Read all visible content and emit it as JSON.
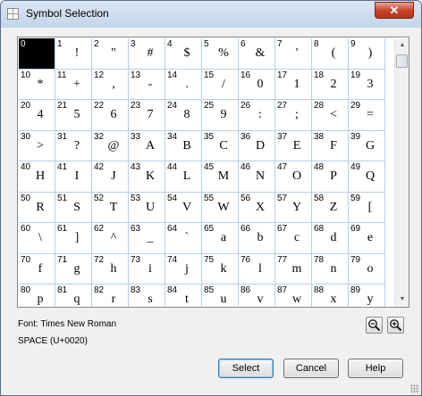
{
  "window": {
    "title": "Symbol Selection",
    "close_glyph": "✕"
  },
  "grid": {
    "columns": 10,
    "selected_code": "0",
    "cells": [
      {
        "code": "0",
        "glyph": ""
      },
      {
        "code": "1",
        "glyph": "!"
      },
      {
        "code": "2",
        "glyph": "\""
      },
      {
        "code": "3",
        "glyph": "#"
      },
      {
        "code": "4",
        "glyph": "$"
      },
      {
        "code": "5",
        "glyph": "%"
      },
      {
        "code": "6",
        "glyph": "&"
      },
      {
        "code": "7",
        "glyph": "'"
      },
      {
        "code": "8",
        "glyph": "("
      },
      {
        "code": "9",
        "glyph": ")"
      },
      {
        "code": "10",
        "glyph": "*"
      },
      {
        "code": "11",
        "glyph": "+"
      },
      {
        "code": "12",
        "glyph": ","
      },
      {
        "code": "13",
        "glyph": "-"
      },
      {
        "code": "14",
        "glyph": "."
      },
      {
        "code": "15",
        "glyph": "/"
      },
      {
        "code": "16",
        "glyph": "0"
      },
      {
        "code": "17",
        "glyph": "1"
      },
      {
        "code": "18",
        "glyph": "2"
      },
      {
        "code": "19",
        "glyph": "3"
      },
      {
        "code": "20",
        "glyph": "4"
      },
      {
        "code": "21",
        "glyph": "5"
      },
      {
        "code": "22",
        "glyph": "6"
      },
      {
        "code": "23",
        "glyph": "7"
      },
      {
        "code": "24",
        "glyph": "8"
      },
      {
        "code": "25",
        "glyph": "9"
      },
      {
        "code": "26",
        "glyph": ":"
      },
      {
        "code": "27",
        "glyph": ";"
      },
      {
        "code": "28",
        "glyph": "<"
      },
      {
        "code": "29",
        "glyph": "="
      },
      {
        "code": "30",
        "glyph": ">"
      },
      {
        "code": "31",
        "glyph": "?"
      },
      {
        "code": "32",
        "glyph": "@"
      },
      {
        "code": "33",
        "glyph": "A"
      },
      {
        "code": "34",
        "glyph": "B"
      },
      {
        "code": "35",
        "glyph": "C"
      },
      {
        "code": "36",
        "glyph": "D"
      },
      {
        "code": "37",
        "glyph": "E"
      },
      {
        "code": "38",
        "glyph": "F"
      },
      {
        "code": "39",
        "glyph": "G"
      },
      {
        "code": "40",
        "glyph": "H"
      },
      {
        "code": "41",
        "glyph": "I"
      },
      {
        "code": "42",
        "glyph": "J"
      },
      {
        "code": "43",
        "glyph": "K"
      },
      {
        "code": "44",
        "glyph": "L"
      },
      {
        "code": "45",
        "glyph": "M"
      },
      {
        "code": "46",
        "glyph": "N"
      },
      {
        "code": "47",
        "glyph": "O"
      },
      {
        "code": "48",
        "glyph": "P"
      },
      {
        "code": "49",
        "glyph": "Q"
      },
      {
        "code": "50",
        "glyph": "R"
      },
      {
        "code": "51",
        "glyph": "S"
      },
      {
        "code": "52",
        "glyph": "T"
      },
      {
        "code": "53",
        "glyph": "U"
      },
      {
        "code": "54",
        "glyph": "V"
      },
      {
        "code": "55",
        "glyph": "W"
      },
      {
        "code": "56",
        "glyph": "X"
      },
      {
        "code": "57",
        "glyph": "Y"
      },
      {
        "code": "58",
        "glyph": "Z"
      },
      {
        "code": "59",
        "glyph": "["
      },
      {
        "code": "60",
        "glyph": "\\"
      },
      {
        "code": "61",
        "glyph": "]"
      },
      {
        "code": "62",
        "glyph": "^"
      },
      {
        "code": "63",
        "glyph": "_"
      },
      {
        "code": "64",
        "glyph": "`"
      },
      {
        "code": "65",
        "glyph": "a"
      },
      {
        "code": "66",
        "glyph": "b"
      },
      {
        "code": "67",
        "glyph": "c"
      },
      {
        "code": "68",
        "glyph": "d"
      },
      {
        "code": "69",
        "glyph": "e"
      },
      {
        "code": "70",
        "glyph": "f"
      },
      {
        "code": "71",
        "glyph": "g"
      },
      {
        "code": "72",
        "glyph": "h"
      },
      {
        "code": "73",
        "glyph": "i"
      },
      {
        "code": "74",
        "glyph": "j"
      },
      {
        "code": "75",
        "glyph": "k"
      },
      {
        "code": "76",
        "glyph": "l"
      },
      {
        "code": "77",
        "glyph": "m"
      },
      {
        "code": "78",
        "glyph": "n"
      },
      {
        "code": "79",
        "glyph": "o"
      },
      {
        "code": "80",
        "glyph": "p"
      },
      {
        "code": "81",
        "glyph": "q"
      },
      {
        "code": "82",
        "glyph": "r"
      },
      {
        "code": "83",
        "glyph": "s"
      },
      {
        "code": "84",
        "glyph": "t"
      },
      {
        "code": "85",
        "glyph": "u"
      },
      {
        "code": "86",
        "glyph": "v"
      },
      {
        "code": "87",
        "glyph": "w"
      },
      {
        "code": "88",
        "glyph": "x"
      },
      {
        "code": "89",
        "glyph": "y"
      }
    ]
  },
  "scrollbar": {
    "up_glyph": "▲",
    "down_glyph": "▼"
  },
  "info": {
    "font_text": "Font:  Times New Roman",
    "char_text": "SPACE (U+0020)"
  },
  "zoom": {
    "out_icon": "zoom-out-icon",
    "in_icon": "zoom-in-icon"
  },
  "buttons": {
    "select": "Select",
    "cancel": "Cancel",
    "help": "Help"
  },
  "colors": {
    "grid_line": "#b9cfe4",
    "selected_cell": "#000000",
    "close_button": "#c7462e"
  }
}
